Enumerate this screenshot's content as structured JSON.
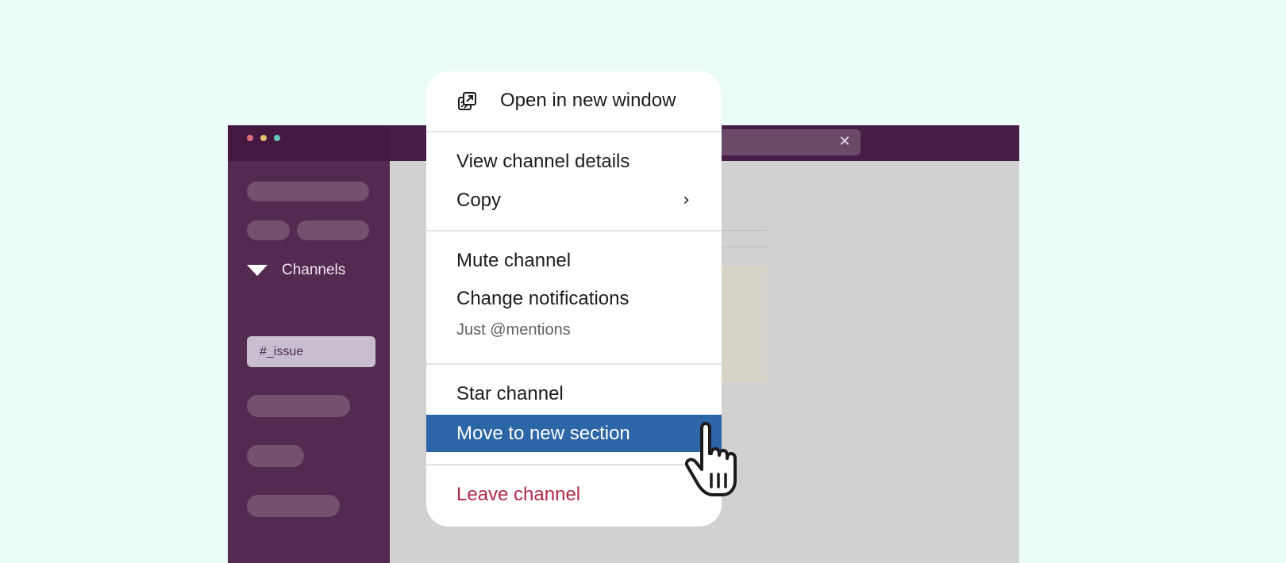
{
  "sidebar": {
    "channels_header": "Channels",
    "active_channel": "#_issue"
  },
  "search": {
    "close_icon": "close-icon"
  },
  "menu": {
    "open_new_window": "Open in new window",
    "view_channel_details": "View channel details",
    "copy": "Copy",
    "copy_submenu_icon": "chevron-right-icon",
    "mute_channel": "Mute channel",
    "change_notifications": "Change notifications",
    "notifications_value": "Just @mentions",
    "star_channel": "Star channel",
    "move_to_new_section": "Move to new section",
    "leave_channel": "Leave channel"
  },
  "colors": {
    "highlight": "#2d66a6",
    "danger": "#b0294a",
    "sidebar": "#542a53",
    "titlebar": "#481d47",
    "background": "#eafbf8"
  }
}
